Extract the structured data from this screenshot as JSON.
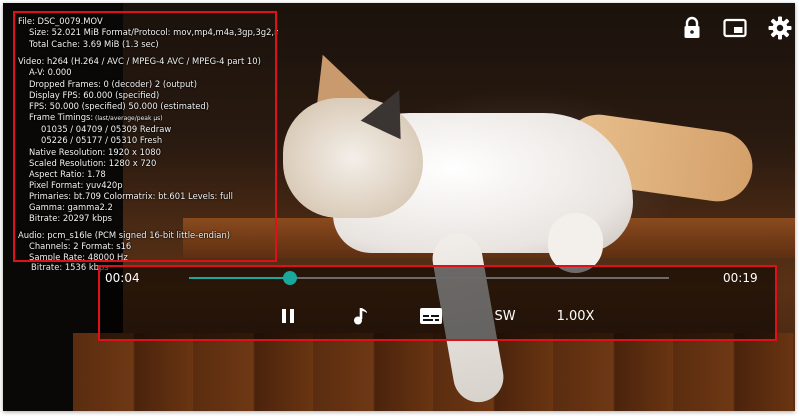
{
  "osd": {
    "file": "File:  DSC_0079.MOV",
    "size": "Size:  52.021 MiB     Format/Protocol:  mov,mp4,m4a,3gp,3g2,mj2",
    "total_cache": "Total Cache:  3.69 MiB  (1.3 sec)",
    "video": "Video:  h264 (H.264 / AVC / MPEG-4 AVC / MPEG-4 part 10)",
    "av": "A-V:   0.000",
    "dropped_frames": "Dropped Frames:   0 (decoder)  2 (output)",
    "display_fps": "Display FPS:  60.000 (specified)",
    "fps": "FPS:  50.000 (specified)  50.000 (estimated)",
    "frame_timings": "Frame Timings:",
    "frame_timings_hint": "(last/average/peak μs)",
    "timing_redraw": "01035 / 04709 / 05309     Redraw",
    "timing_fresh": "05226 / 05177 / 05310     Fresh",
    "native_resolution": "Native Resolution:  1920 x 1080",
    "scaled_resolution": "Scaled Resolution:  1280 x 720",
    "aspect_ratio": "Aspect Ratio:  1.78",
    "pixel_format": "Pixel Format:  yuv420p",
    "primaries": "Primaries:  bt.709     Colormatrix:  bt.601     Levels:  full",
    "gamma": "Gamma:  gamma2.2",
    "video_bitrate": "Bitrate:  20297 kbps",
    "audio": "Audio:  pcm_s16le (PCM signed 16-bit little-endian)",
    "channels": "Channels:  2     Format:  s16",
    "sample_rate": "Sample Rate:  48000 Hz",
    "audio_bitrate": "Bitrate:  1536 kbps"
  },
  "top_icons": [
    "lock-icon",
    "picture-in-picture-icon",
    "gear-icon"
  ],
  "player": {
    "current_time": "00:04",
    "total_time": "00:19",
    "progress": 0.21,
    "decoder_label": "SW",
    "speed_label": "1.00X"
  },
  "colors": {
    "accent": "#1aa79c",
    "highlight_border": "#e0101a"
  }
}
